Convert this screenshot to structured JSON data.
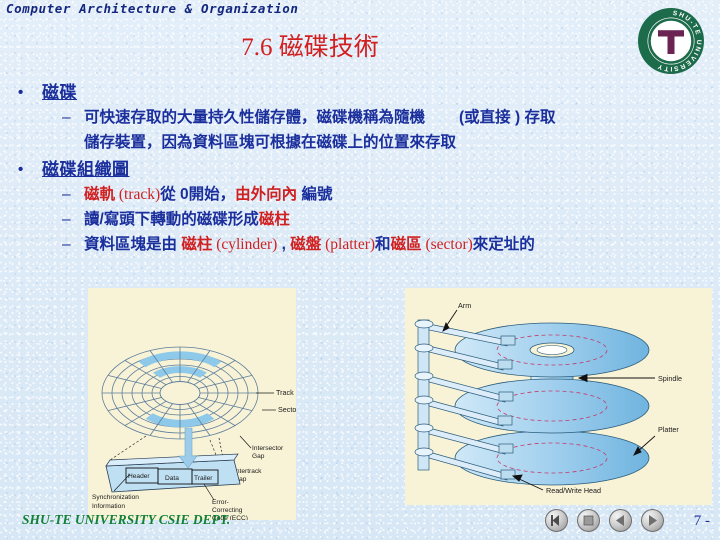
{
  "header": {
    "course": "Computer Architecture & Organization",
    "title": "7.6 磁碟技術"
  },
  "logo": {
    "ring_text": "SHU-TE UNIVERSITY",
    "monogram": "T",
    "ring_color": "#1c6b4b",
    "monogram_color": "#6b2352"
  },
  "content": {
    "bullet1": {
      "marker": "•",
      "label": "磁碟",
      "sub": [
        {
          "marker": "–",
          "line1_a": "可快速存取的大量持久性儲存體，磁碟機稱為隨機",
          "line1_b": "(或直接 ) 存取",
          "line2": "儲存裝置，因為資料區塊可根據在磁碟上的位置來存取"
        }
      ]
    },
    "bullet2": {
      "marker": "•",
      "label": "磁碟組織圖",
      "sub": [
        {
          "marker": "–",
          "seg": [
            {
              "t": "磁軌",
              "c": "red"
            },
            {
              "t": " (track)",
              "c": "red-lat"
            },
            {
              "t": "從 0開始，",
              "c": "blue"
            },
            {
              "t": "由外向內",
              "c": "red"
            },
            {
              "t": " 編號",
              "c": "blue"
            }
          ]
        },
        {
          "marker": "–",
          "seg": [
            {
              "t": "讀/寫頭下轉動的磁碟形成",
              "c": "blue"
            },
            {
              "t": "磁柱",
              "c": "red"
            }
          ]
        },
        {
          "marker": "–",
          "seg": [
            {
              "t": "資料區塊是由 ",
              "c": "blue"
            },
            {
              "t": "磁柱",
              "c": "red"
            },
            {
              "t": " (cylinder)",
              "c": "red-lat"
            },
            {
              "t": " , ",
              "c": "blue"
            },
            {
              "t": "磁盤",
              "c": "red"
            },
            {
              "t": " (platter)",
              "c": "red-lat"
            },
            {
              "t": "和",
              "c": "blue"
            },
            {
              "t": "磁區",
              "c": "red"
            },
            {
              "t": " (sector)",
              "c": "red-lat"
            },
            {
              "t": "來定址的",
              "c": "blue"
            }
          ]
        }
      ]
    }
  },
  "figure_left": {
    "caption": "disk-track-sector-diagram",
    "labels": {
      "track": "Track",
      "sector": "Sector",
      "intersector_gap": "Intersector\nGap",
      "intertrack_gap": "Intertrack\nGap",
      "header": "Header",
      "data": "Data",
      "trailer": "Trailer",
      "sync_info": "Synchronization\nInformation",
      "ecc": "Error-\nCorrecting\nCode (ECC)"
    },
    "label_lines": {
      "intersector_gap": [
        "Intersector",
        "Gap"
      ],
      "intertrack_gap": [
        "Intertrack",
        "Gap"
      ],
      "sync_info": [
        "Synchronization",
        "Information"
      ],
      "ecc": [
        "Error-",
        "Correcting",
        "Code (ECC)"
      ]
    }
  },
  "figure_right": {
    "caption": "disk-platter-stack-diagram",
    "labels": {
      "arm": "Arm",
      "spindle": "Spindle",
      "platter": "Platter",
      "read_write_head": "Read/Write Head"
    }
  },
  "footer": {
    "org": "SHU-TE UNIVERSITY  CSIE DEPT.",
    "page": "7 -",
    "nav": [
      {
        "name": "nav-first-slide",
        "glyph": "first"
      },
      {
        "name": "nav-home",
        "glyph": "home"
      },
      {
        "name": "nav-previous",
        "glyph": "prev"
      },
      {
        "name": "nav-next",
        "glyph": "next"
      }
    ]
  },
  "colors": {
    "background": "#dce9f5",
    "title_red": "#d22020",
    "text_blue": "#1b2f9c",
    "footer_green": "#138038",
    "figure_bg": "#f8f3d6",
    "platter_blue": "#a8d3ef"
  }
}
